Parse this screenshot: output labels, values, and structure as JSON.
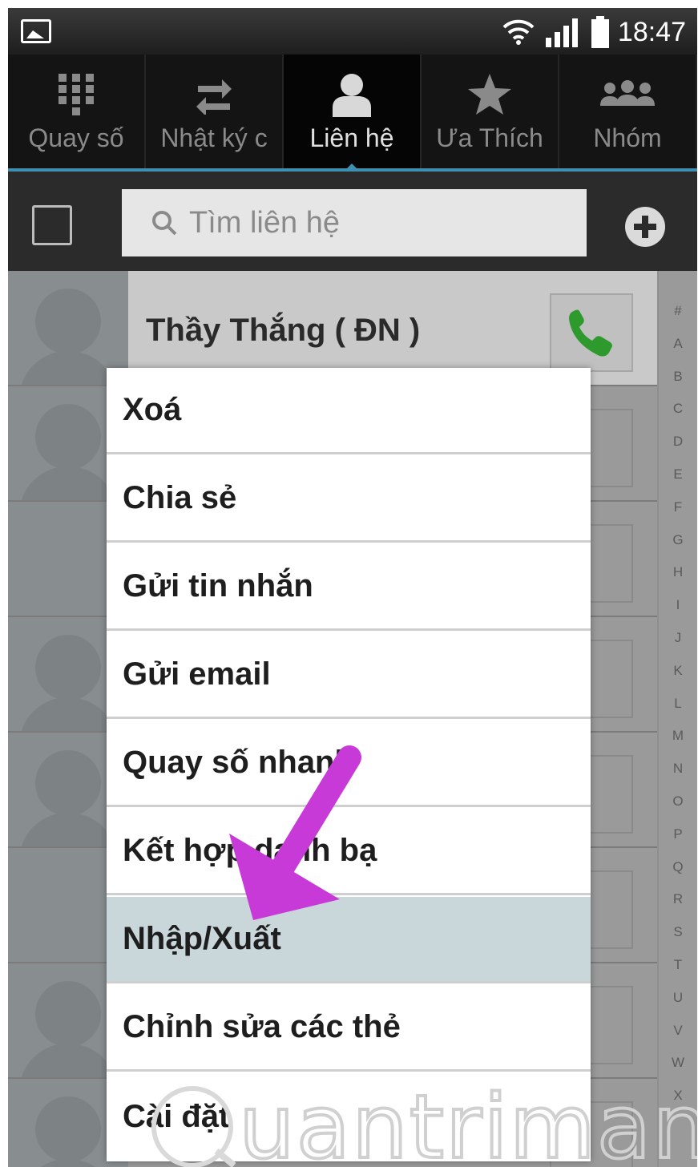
{
  "status_bar": {
    "time": "18:47",
    "icons": [
      "gallery-icon",
      "wifi-icon",
      "signal-icon",
      "battery-icon"
    ]
  },
  "tabs": [
    {
      "label": "Quay số",
      "icon": "dialpad-icon",
      "active": false
    },
    {
      "label": "Nhật ký c",
      "icon": "call-log-icon",
      "active": false
    },
    {
      "label": "Liên hệ",
      "icon": "contacts-icon",
      "active": true
    },
    {
      "label": "Ưa Thích",
      "icon": "star-icon",
      "active": false
    },
    {
      "label": "Nhóm",
      "icon": "groups-icon",
      "active": false
    }
  ],
  "search": {
    "placeholder": "Tìm liên hệ",
    "qr_icon": "qr-scan-icon",
    "add_icon": "add-contact-icon"
  },
  "contacts": [
    {
      "name": "Thầy Thắng ( ĐN )"
    }
  ],
  "alphabet_index": [
    "#",
    "A",
    "B",
    "C",
    "D",
    "E",
    "F",
    "G",
    "H",
    "I",
    "J",
    "K",
    "L",
    "M",
    "N",
    "O",
    "P",
    "Q",
    "R",
    "S",
    "T",
    "U",
    "V",
    "W",
    "X"
  ],
  "context_menu": {
    "items": [
      {
        "label": "Xoá",
        "selected": false
      },
      {
        "label": "Chia sẻ",
        "selected": false
      },
      {
        "label": "Gửi tin nhắn",
        "selected": false
      },
      {
        "label": "Gửi email",
        "selected": false
      },
      {
        "label": "Quay số nhanh",
        "selected": false
      },
      {
        "label": "Kết hợp danh bạ",
        "selected": false
      },
      {
        "label": "Nhập/Xuất",
        "selected": true
      },
      {
        "label": "Chỉnh sửa các thẻ",
        "selected": false
      },
      {
        "label": "Cài đặt",
        "selected": false
      }
    ]
  },
  "annotation": {
    "arrow_color": "#c83ad8"
  },
  "watermark": {
    "text": "Quantrimang"
  },
  "colors": {
    "accent": "#3e8fb0",
    "call_green": "#2e9a2e",
    "menu_selected": "#c9d6da"
  }
}
